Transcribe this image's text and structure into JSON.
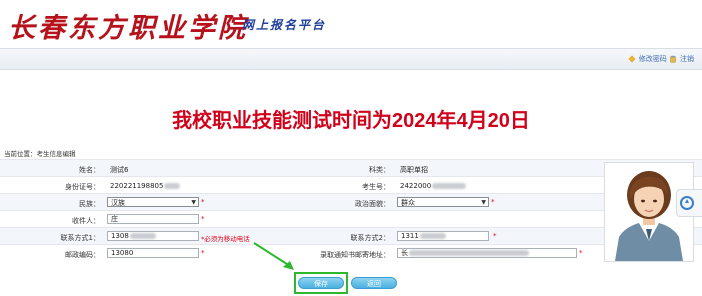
{
  "header": {
    "school_name": "长春东方职业学院",
    "platform_name": "网上报名平台"
  },
  "toplinks": {
    "change_password": "修改密码",
    "logout": "注销"
  },
  "notice": "我校职业技能测试时间为2024年4月20日",
  "location": "当前位置：考生信息编辑",
  "form": {
    "name_label": "姓名：",
    "name_value": "测试6",
    "category_label": "科类：",
    "category_value": "高职单招",
    "idcard_label": "身份证号：",
    "idcard_value": "220221198805",
    "exam_no_label": "考生号：",
    "exam_no_value": "2422000",
    "nation_label": "民族：",
    "nation_value": "汉族",
    "politics_label": "政治面貌：",
    "politics_value": "群众",
    "receiver_label": "收件人：",
    "receiver_value": "庄",
    "contact1_label": "联系方式1：",
    "contact1_value": "1308",
    "contact1_hint": "*必须为移动电话",
    "contact2_label": "联系方式2：",
    "contact2_value": "1311",
    "postcode_label": "邮政编码：",
    "postcode_value": "13080",
    "address_label": "录取通知书邮寄地址：",
    "address_value": "长",
    "required_mark": "*"
  },
  "buttons": {
    "save": "保存",
    "back": "返回"
  },
  "colors": {
    "accent_red": "#d0021b",
    "platform_blue": "#1f3f9b",
    "button_blue": "#4ab0df",
    "highlight_green": "#2eb82e"
  }
}
